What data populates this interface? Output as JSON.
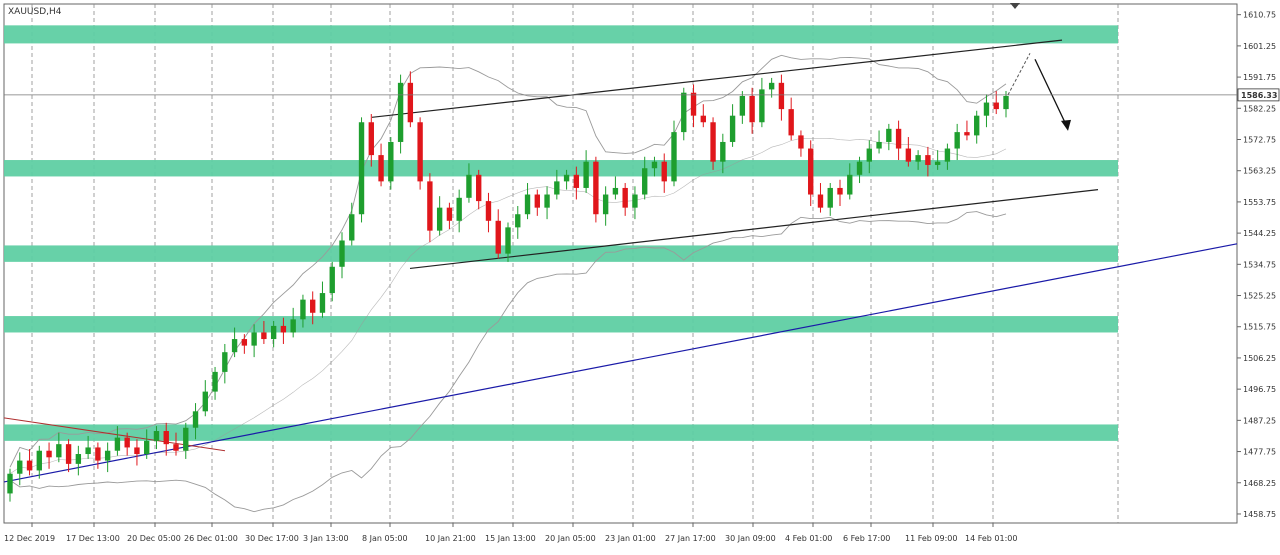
{
  "symbol_label": "XAUUSD,H4",
  "current_price_label": "1586.33",
  "colors": {
    "up": "#1e9e2e",
    "down": "#e0161b",
    "zone": "#5fcfa3",
    "trend": "#1a1aa8",
    "channel": "#222222",
    "bands": "#9a9a9a",
    "grid": "#8a8a8a"
  },
  "chart_data": {
    "type": "candlestick",
    "title": "XAUUSD,H4",
    "xlabel": "",
    "ylabel": "",
    "ylim": [
      1456.0,
      1614.0
    ],
    "y_ticks": [
      "1610.75",
      "1601.25",
      "1591.75",
      "1582.25",
      "1572.75",
      "1563.25",
      "1553.75",
      "1544.25",
      "1534.75",
      "1525.25",
      "1515.75",
      "1506.25",
      "1496.75",
      "1487.25",
      "1477.75",
      "1468.25",
      "1458.75"
    ],
    "x_ticks": [
      "12 Dec 2019",
      "17 Dec 13:00",
      "20 Dec 05:00",
      "26 Dec 01:00",
      "30 Dec 17:00",
      "3 Jan 13:00",
      "8 Jan 05:00",
      "10 Jan 21:00",
      "15 Jan 13:00",
      "20 Jan 05:00",
      "23 Jan 01:00",
      "27 Jan 17:00",
      "30 Jan 09:00",
      "4 Feb 01:00",
      "6 Feb 17:00",
      "11 Feb 09:00",
      "14 Feb 01:00"
    ],
    "current_price": 1586.33,
    "series": [
      {
        "style": "candles",
        "points": [
          [
            1465,
            1471
          ],
          [
            1471,
            1475
          ],
          [
            1475,
            1472
          ],
          [
            1472,
            1478
          ],
          [
            1478,
            1476
          ],
          [
            1476,
            1480
          ],
          [
            1480,
            1474
          ],
          [
            1474,
            1477
          ],
          [
            1477,
            1479
          ],
          [
            1479,
            1475
          ],
          [
            1475,
            1478
          ],
          [
            1478,
            1482
          ],
          [
            1482,
            1479
          ],
          [
            1479,
            1477
          ],
          [
            1477,
            1481
          ],
          [
            1481,
            1484
          ],
          [
            1484,
            1480
          ],
          [
            1480,
            1478
          ],
          [
            1478,
            1485
          ],
          [
            1485,
            1490
          ],
          [
            1490,
            1496
          ],
          [
            1496,
            1502
          ],
          [
            1502,
            1508
          ],
          [
            1508,
            1512
          ],
          [
            1512,
            1510
          ],
          [
            1510,
            1514
          ],
          [
            1514,
            1512
          ],
          [
            1512,
            1516
          ],
          [
            1516,
            1514
          ],
          [
            1514,
            1518
          ],
          [
            1518,
            1524
          ],
          [
            1524,
            1520
          ],
          [
            1520,
            1526
          ],
          [
            1526,
            1534
          ],
          [
            1534,
            1542
          ],
          [
            1542,
            1550
          ],
          [
            1550,
            1578
          ],
          [
            1578,
            1568
          ],
          [
            1568,
            1560
          ],
          [
            1560,
            1572
          ],
          [
            1572,
            1590
          ],
          [
            1590,
            1578
          ],
          [
            1578,
            1560
          ],
          [
            1560,
            1545
          ],
          [
            1545,
            1552
          ],
          [
            1552,
            1548
          ],
          [
            1548,
            1555
          ],
          [
            1555,
            1562
          ],
          [
            1562,
            1554
          ],
          [
            1554,
            1548
          ],
          [
            1548,
            1538
          ],
          [
            1538,
            1546
          ],
          [
            1546,
            1550
          ],
          [
            1550,
            1556
          ],
          [
            1556,
            1552
          ],
          [
            1552,
            1556
          ],
          [
            1556,
            1560
          ],
          [
            1560,
            1562
          ],
          [
            1562,
            1558
          ],
          [
            1558,
            1566
          ],
          [
            1566,
            1550
          ],
          [
            1550,
            1556
          ],
          [
            1556,
            1558
          ],
          [
            1558,
            1552
          ],
          [
            1552,
            1556
          ],
          [
            1556,
            1564
          ],
          [
            1564,
            1566
          ],
          [
            1566,
            1560
          ],
          [
            1560,
            1575
          ],
          [
            1575,
            1587
          ],
          [
            1587,
            1580
          ],
          [
            1580,
            1578
          ],
          [
            1578,
            1566
          ],
          [
            1566,
            1572
          ],
          [
            1572,
            1580
          ],
          [
            1580,
            1586
          ],
          [
            1586,
            1578
          ],
          [
            1578,
            1588
          ],
          [
            1588,
            1590
          ],
          [
            1590,
            1582
          ],
          [
            1582,
            1574
          ],
          [
            1574,
            1570
          ],
          [
            1570,
            1556
          ],
          [
            1556,
            1552
          ],
          [
            1552,
            1558
          ],
          [
            1558,
            1556
          ],
          [
            1556,
            1562
          ],
          [
            1562,
            1566
          ],
          [
            1566,
            1570
          ],
          [
            1570,
            1572
          ],
          [
            1572,
            1576
          ],
          [
            1576,
            1570
          ],
          [
            1570,
            1566
          ],
          [
            1566,
            1568
          ],
          [
            1568,
            1565
          ],
          [
            1565,
            1566
          ],
          [
            1566,
            1570
          ],
          [
            1570,
            1575
          ],
          [
            1575,
            1574
          ],
          [
            1574,
            1580
          ],
          [
            1580,
            1584
          ],
          [
            1584,
            1582
          ],
          [
            1582,
            1586
          ]
        ]
      },
      {
        "style": "line",
        "name": "",
        "values": [
          1601.25,
          1586.33
        ]
      },
      {
        "style": "bands",
        "name": "",
        "values": []
      }
    ],
    "zones": [
      [
        1602.0,
        1607.5
      ],
      [
        1561.5,
        1566.5
      ],
      [
        1535.5,
        1540.5
      ],
      [
        1514.0,
        1519.0
      ],
      [
        1481.0,
        1486.0
      ]
    ],
    "trendlines": [
      {
        "style": "blue",
        "from": [
          "12 Dec 2019",
          1468.5
        ],
        "to": [
          "14 Feb 01:00",
          1541.0
        ]
      },
      {
        "style": "channel-upper",
        "from": [
          "8 Jan 05:00",
          1579.5
        ],
        "to": [
          "14 Feb 01:00",
          1603.0
        ]
      },
      {
        "style": "channel-lower",
        "from": [
          "10 Jan 21:00",
          1533.5
        ],
        "to": [
          "14 Feb 01:00",
          1557.5
        ]
      },
      {
        "style": "red",
        "from": [
          "12 Dec 2019",
          1488.0
        ],
        "to": [
          "26 Dec 01:00",
          1478.0
        ]
      }
    ],
    "projection": {
      "points": [
        [
          1586.33,
          1599.0
        ],
        [
          1599.0,
          1576.0
        ]
      ]
    },
    "grid": true
  }
}
